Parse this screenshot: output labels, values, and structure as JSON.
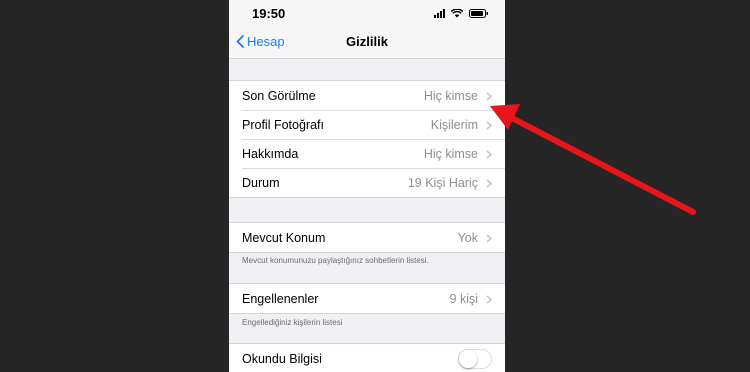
{
  "status_bar": {
    "time": "19:50"
  },
  "nav": {
    "back_label": "Hesap",
    "title": "Gizlilik"
  },
  "section1": {
    "rows": [
      {
        "label": "Son Görülme",
        "value": "Hiç kimse"
      },
      {
        "label": "Profil Fotoğrafı",
        "value": "Kişilerim"
      },
      {
        "label": "Hakkımda",
        "value": "Hiç kimse"
      },
      {
        "label": "Durum",
        "value": "19 Kişi Hariç"
      }
    ]
  },
  "section2": {
    "rows": [
      {
        "label": "Mevcut Konum",
        "value": "Yok"
      }
    ],
    "footer": "Mevcut konumunuzu paylaştığınız sohbetlerin listesi."
  },
  "section3": {
    "rows": [
      {
        "label": "Engellenenler",
        "value": "9 kişi"
      }
    ],
    "footer": "Engellediğiniz kişilerin listesi"
  },
  "section4": {
    "rows": [
      {
        "label": "Okundu Bilgisi",
        "toggle_on": false
      }
    ]
  },
  "colors": {
    "accent": "#1b7cf5",
    "annotation_arrow": "#e8161b",
    "background": "#262626"
  },
  "icons": [
    "back-chevron-icon",
    "chevron-right-icon",
    "signal-icon",
    "wifi-icon",
    "battery-icon"
  ]
}
